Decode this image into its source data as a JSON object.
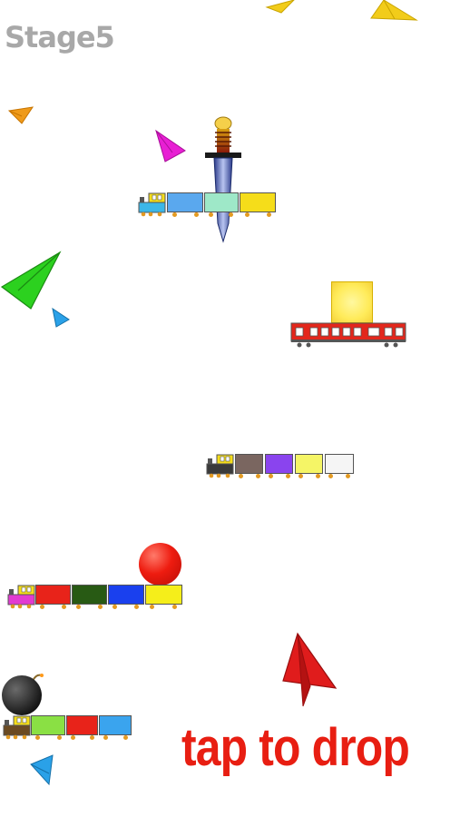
{
  "hud": {
    "stage_label": "Stage5",
    "instruction_label": "tap to drop"
  },
  "colors": {
    "stage_text": "#a8a8a8",
    "instruction_text": "#e81e12",
    "ball": "#ee1c10",
    "bomb": "#222222",
    "gold_block": "#fff07a",
    "express_car": "#e3271c"
  },
  "scene": {
    "paper_planes": [
      {
        "name": "paper-plane-yellow-top-left",
        "color": "#f2cc1a"
      },
      {
        "name": "paper-plane-yellow-top-right",
        "color": "#f2cc1a"
      },
      {
        "name": "paper-plane-orange",
        "color": "#ef9a1a"
      },
      {
        "name": "paper-plane-magenta",
        "color": "#e81fd4"
      },
      {
        "name": "paper-plane-green",
        "color": "#2cd11f"
      },
      {
        "name": "paper-plane-blue-small",
        "color": "#2aa1e8"
      },
      {
        "name": "paper-plane-red-pointer",
        "color": "#e01c1c"
      },
      {
        "name": "paper-plane-blue-bottom",
        "color": "#2aa1e8"
      }
    ],
    "trains": [
      {
        "name": "train-1",
        "loco": "#3cb7e8",
        "cars": [
          "#5aa8ee",
          "#9ee8c8",
          "#f5dd1a"
        ]
      },
      {
        "name": "train-2",
        "loco": "#3a3a3a",
        "cars": [
          "#7a6660",
          "#8a44ee",
          "#f5f566",
          "#f5f5f5"
        ]
      },
      {
        "name": "train-3",
        "loco": "#e23ad1",
        "cars": [
          "#e8231a",
          "#285a14",
          "#1a40ee",
          "#f5ee1a"
        ]
      },
      {
        "name": "train-4",
        "loco": "#6b4a22",
        "cars": [
          "#8ae044",
          "#e8231a",
          "#3aa4ee"
        ]
      }
    ]
  }
}
